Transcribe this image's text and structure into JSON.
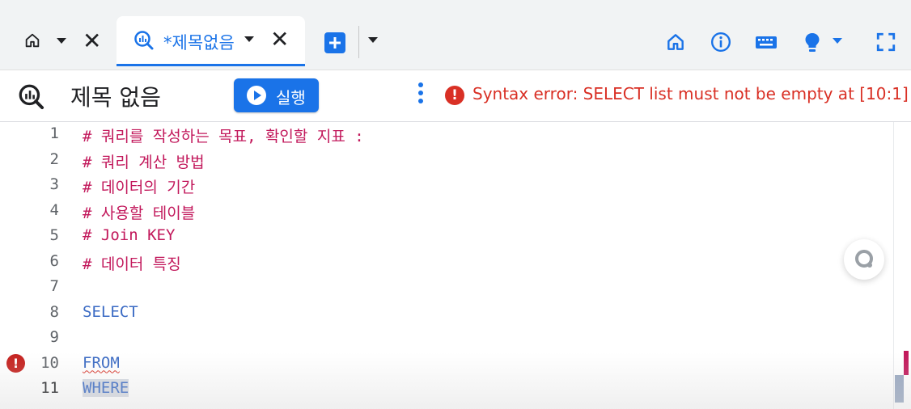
{
  "tabs": {
    "home_tab": {
      "home_icon": "home-icon",
      "menu_icon": "caret-down-icon",
      "close_icon": "close-icon",
      "close_glyph": "✕"
    },
    "active_tab": {
      "icon": "query-icon",
      "title": "*제목없음",
      "menu_icon": "caret-down-icon",
      "close_glyph": "✕"
    },
    "new_tab": {
      "icon": "plus-square-icon",
      "menu_icon": "caret-down-icon"
    },
    "right_icons": [
      "home-icon",
      "info-icon",
      "keyboard-icon",
      "lightbulb-icon",
      "fullscreen-icon"
    ]
  },
  "toolbar": {
    "query_icon": "query-icon",
    "title": "제목 없음",
    "run_label": "실행",
    "more_icon": "more-vert-icon",
    "error_icon_glyph": "!",
    "error_message": "Syntax error: SELECT list must not be empty at [10:1]"
  },
  "editor": {
    "active_line": 11,
    "error_line": 10,
    "error_glyph": "!",
    "lines": [
      {
        "n": "1",
        "text": "# 쿼리를 작성하는 목표, 확인할 지표 :",
        "kind": "comment"
      },
      {
        "n": "2",
        "text": "# 쿼리 계산 방법",
        "kind": "comment"
      },
      {
        "n": "3",
        "text": "# 데이터의 기간",
        "kind": "comment"
      },
      {
        "n": "4",
        "text": "# 사용할 테이블",
        "kind": "comment"
      },
      {
        "n": "5",
        "text": "# Join KEY",
        "kind": "comment"
      },
      {
        "n": "6",
        "text": "# 데이터 특징",
        "kind": "comment"
      },
      {
        "n": "7",
        "text": "",
        "kind": "empty"
      },
      {
        "n": "8",
        "text": "SELECT",
        "kind": "keyword"
      },
      {
        "n": "9",
        "text": "",
        "kind": "empty"
      },
      {
        "n": "10",
        "text": "FROM",
        "kind": "keyword"
      },
      {
        "n": "11",
        "text": "WHERE",
        "kind": "keyword"
      }
    ]
  },
  "floating_button": {
    "icon": "search-assist-icon"
  },
  "colors": {
    "accent": "#1a73e8",
    "error": "#d93025",
    "comment": "#c2185b",
    "keyword": "#3b6bc4"
  }
}
